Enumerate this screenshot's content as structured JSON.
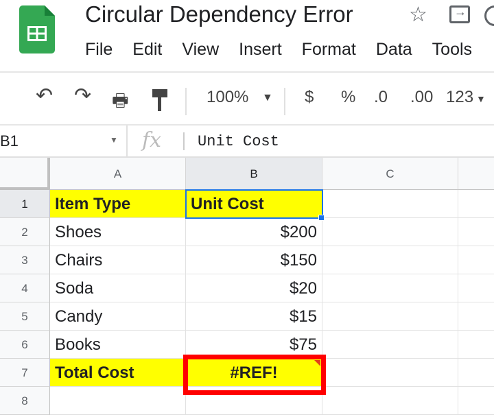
{
  "app": {
    "title": "Circular Dependency Error",
    "accent": "#34a853"
  },
  "menu": [
    "File",
    "Edit",
    "View",
    "Insert",
    "Format",
    "Data",
    "Tools"
  ],
  "toolbar": {
    "zoom": "100%",
    "currency": "$",
    "percent": "%",
    "dec_decrease": ".0",
    "dec_increase": ".00",
    "more_formats": "123"
  },
  "formula_bar": {
    "cell_ref": "B1",
    "fx": "fx",
    "value": "Unit Cost"
  },
  "columns": [
    "A",
    "B",
    "C"
  ],
  "rows": [
    "1",
    "2",
    "3",
    "4",
    "5",
    "6",
    "7",
    "8"
  ],
  "cells": [
    [
      "Item Type",
      "Unit Cost",
      ""
    ],
    [
      "Shoes",
      "$200",
      ""
    ],
    [
      "Chairs",
      "$150",
      ""
    ],
    [
      "Soda",
      "$20",
      ""
    ],
    [
      "Candy",
      "$15",
      ""
    ],
    [
      "Books",
      "$75",
      ""
    ],
    [
      "Total Cost",
      "#REF!",
      ""
    ],
    [
      "",
      "",
      ""
    ]
  ],
  "colors": {
    "highlight": "#ffff00",
    "error_box": "#ff0000",
    "selection": "#1a73e8"
  }
}
